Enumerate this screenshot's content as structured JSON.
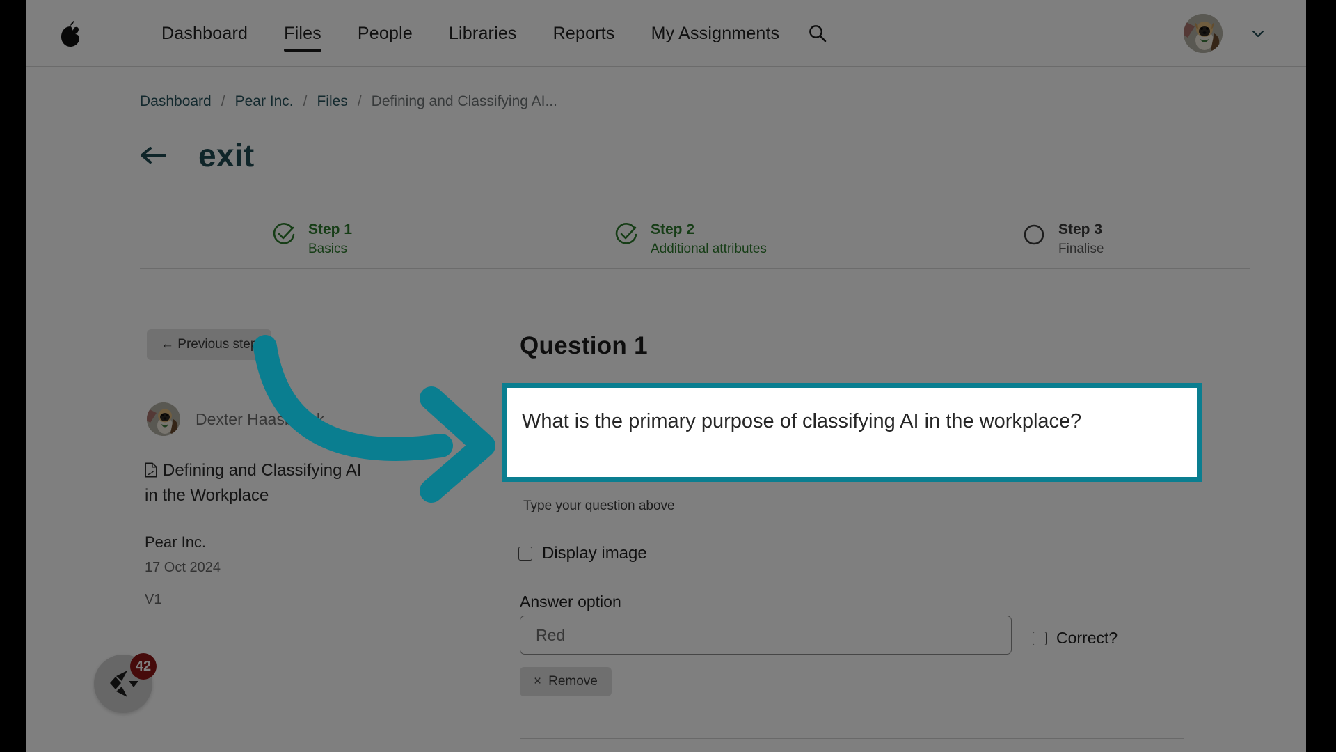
{
  "topnav": {
    "logo_icon": "pear-logo-icon",
    "items": [
      {
        "label": "Dashboard",
        "active": false
      },
      {
        "label": "Files",
        "active": true
      },
      {
        "label": "People",
        "active": false
      },
      {
        "label": "Libraries",
        "active": false
      },
      {
        "label": "Reports",
        "active": false
      },
      {
        "label": "My Assignments",
        "active": false
      }
    ],
    "search_icon": "search-icon",
    "avatar_icon": "user-avatar",
    "chevron_icon": "chevron-down-icon"
  },
  "breadcrumb": {
    "items": [
      "Dashboard",
      "Pear Inc.",
      "Files"
    ],
    "current": "Defining and Classifying AI...",
    "separator": "/"
  },
  "header": {
    "back_icon": "arrow-left-icon",
    "title": "exit"
  },
  "stepper": {
    "steps": [
      {
        "title": "Step 1",
        "subtitle": "Basics",
        "state": "done",
        "icon": "check-circle-icon"
      },
      {
        "title": "Step 2",
        "subtitle": "Additional attributes",
        "state": "done",
        "icon": "check-circle-icon"
      },
      {
        "title": "Step 3",
        "subtitle": "Finalise",
        "state": "todo",
        "icon": "empty-circle-icon"
      }
    ]
  },
  "sidebar": {
    "previous_step_label": "← Previous step",
    "owner_name": "Dexter Haasbroek",
    "owner_avatar_icon": "owner-avatar",
    "file_icon": "document-file-icon",
    "file_title": "Defining and Classifying AI in the Workplace",
    "organisation": "Pear Inc.",
    "date": "17 Oct 2024",
    "version": "V1"
  },
  "question": {
    "heading": "Question 1",
    "text": "What is the primary purpose of classifying AI in the workplace?",
    "helper": "Type your question above",
    "display_image_label": "Display image",
    "display_image_checked": false,
    "answer_option_label": "Answer option",
    "answer_option_value": "",
    "answer_option_placeholder": "Red",
    "correct_label": "Correct?",
    "correct_checked": false,
    "remove_label": "Remove",
    "remove_icon": "close-x-icon"
  },
  "widget": {
    "icon": "camtasia-widget-icon",
    "badge_count": "42"
  },
  "colors": {
    "accent_teal": "#0a7e90",
    "brand_dark_teal": "#1f4a52",
    "link_teal": "#27535c",
    "step_done_green": "#2d7a2d",
    "badge_red": "#8c1616"
  }
}
